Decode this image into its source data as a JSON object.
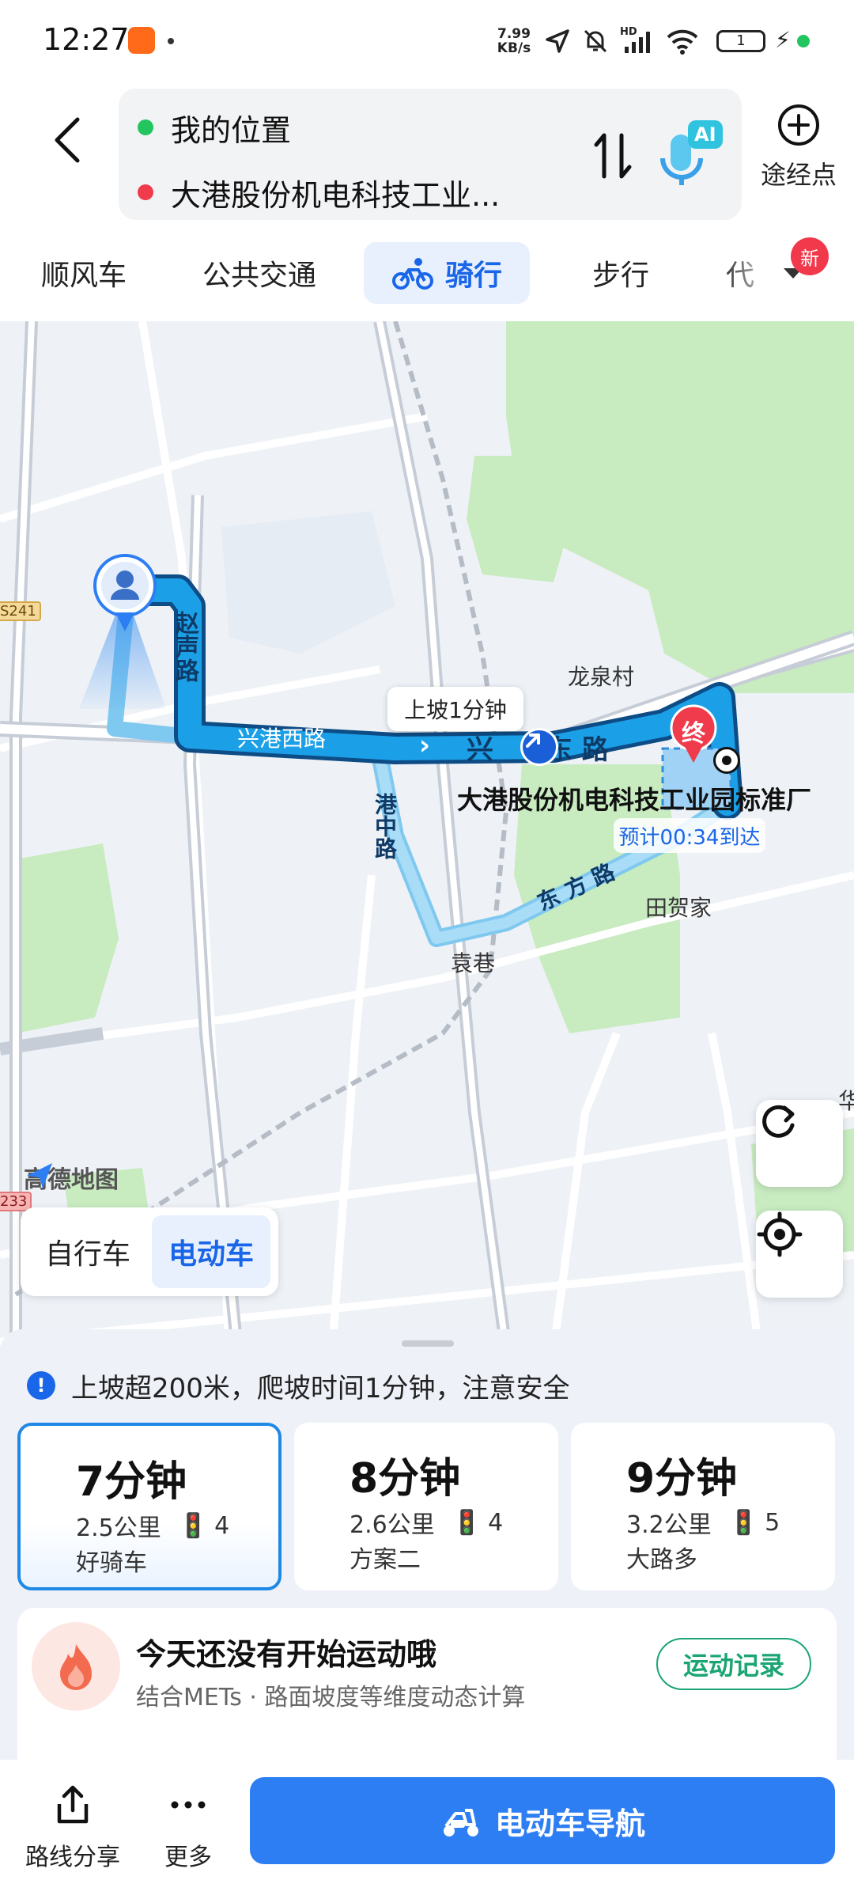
{
  "status_bar": {
    "time": "12:27",
    "net_speed_value": "7.99",
    "net_speed_unit": "KB/s",
    "battery_level": "1",
    "signal_label": "HD"
  },
  "header": {
    "origin": "我的位置",
    "destination": "大港股份机电科技工业...",
    "ai_badge": "AI",
    "waypoint_label": "途经点"
  },
  "tabs": [
    {
      "label": "顺风车"
    },
    {
      "label": "公共交通"
    },
    {
      "label": "骑行"
    },
    {
      "label": "步行"
    },
    {
      "label": "代"
    }
  ],
  "new_badge": "新",
  "map": {
    "labels": {
      "village_longquan": "龙泉村",
      "village_tianhejia": "田贺家",
      "village_yuanxiang": "袁巷"
    },
    "roads": {
      "zhaosheng": "赵声路",
      "xinggang_west": "兴港西路",
      "xinggang_east_a": "兴",
      "xinggang_east_b": "东 路",
      "ganzhong": "港中路",
      "dongfang": "东 方 路"
    },
    "shields": {
      "s241": "S241",
      "s233": "233"
    },
    "climb_bubble": "上坡1分钟",
    "end_marker": "终",
    "destination_name": "大港股份机电科技工业园标准厂",
    "eta": "预计00:34到达",
    "edge_char": "华",
    "logo_text": "高德地图"
  },
  "vehicle_toggle": {
    "bike": "自行车",
    "ebike": "电动车"
  },
  "sheet": {
    "warning": "上坡超200米，爬坡时间1分钟，注意安全",
    "plans": [
      {
        "time": "7分钟",
        "distance": "2.5公里",
        "lights": "4",
        "name": "好骑车"
      },
      {
        "time": "8分钟",
        "distance": "2.6公里",
        "lights": "4",
        "name": "方案二"
      },
      {
        "time": "9分钟",
        "distance": "3.2公里",
        "lights": "5",
        "name": "大路多"
      }
    ],
    "sport": {
      "title": "今天还没有开始运动哦",
      "subtitle": "结合METs · 路面坡度等维度动态计算",
      "button": "运动记录"
    }
  },
  "bottom_bar": {
    "share": "路线分享",
    "more": "更多",
    "navigate": "电动车导航"
  },
  "colors": {
    "accent": "#1a66e8",
    "route": "#1ba0e8",
    "nav_button": "#2d7ef3",
    "end_marker": "#ef3b4b",
    "sport_green": "#1aa572"
  }
}
